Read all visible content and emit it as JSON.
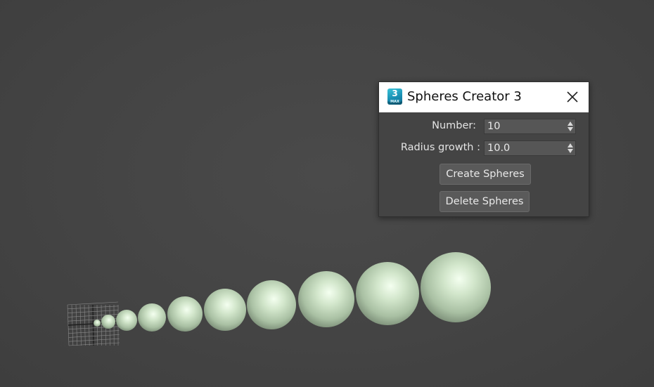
{
  "dialog": {
    "title": "Spheres Creator 3",
    "app_icon": {
      "name": "3ds-max-icon",
      "number": "3",
      "sub": "MAX",
      "color": "#1a8fb3"
    },
    "close_icon": "close-icon",
    "number_label": "Number:",
    "number_value": "10",
    "radius_label": "Radius growth :",
    "radius_value": "10.0",
    "create_label": "Create Spheres",
    "delete_label": "Delete Spheres"
  },
  "viewport": {
    "background_color": "#444444",
    "sphere_color": "#c8dcc0",
    "sphere_count": 10
  }
}
